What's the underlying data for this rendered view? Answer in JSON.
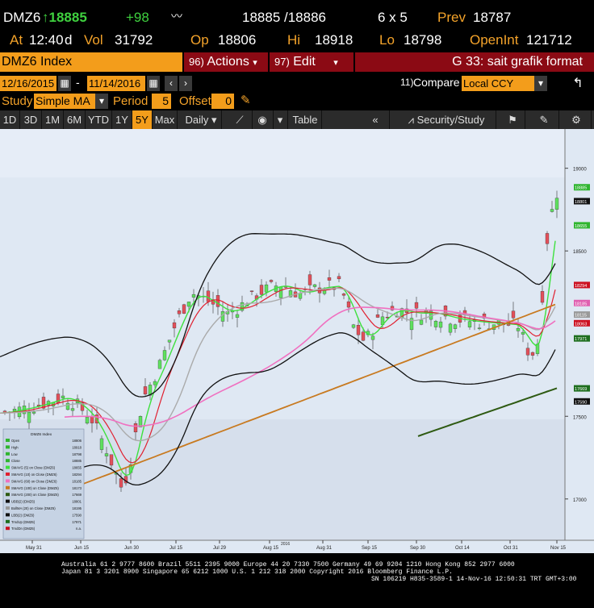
{
  "header": {
    "ticker": "DMZ6",
    "last": "↑18885",
    "change": "+98",
    "bid_ask": "18885 /18886",
    "size": "6 x 5",
    "prev_label": "Prev",
    "prev_value": "18787",
    "at_label": "At",
    "time": "12:40",
    "time_suffix": "d",
    "vol_label": "Vol",
    "vol_value": "31792",
    "op_label": "Op",
    "op_value": "18806",
    "hi_label": "Hi",
    "hi_value": "18918",
    "lo_label": "Lo",
    "lo_value": "18798",
    "oi_label": "OpenInt",
    "oi_value": "121712"
  },
  "command": {
    "security": "DMZ6 Index",
    "actions_num": "96)",
    "actions_label": "Actions",
    "edit_num": "97)",
    "edit_label": "Edit",
    "title": "G 33: sait grafik format"
  },
  "range": {
    "start": "12/16/2015",
    "end": "11/14/2016",
    "compare_num": "11)",
    "compare_label": "Compare",
    "compare_value": "Local CCY"
  },
  "study": {
    "label": "Study",
    "value": "Simple MA",
    "period_label": "Period",
    "period_value": "5",
    "offset_label": "Offset",
    "offset_value": "0"
  },
  "toolbar": {
    "periods": [
      "1D",
      "3D",
      "1M",
      "6M",
      "YTD",
      "1Y",
      "5Y",
      "Max"
    ],
    "active_period": "5Y",
    "frequency": "Daily",
    "table": "Table",
    "security_study": "Security/Study"
  },
  "chart_data": {
    "type": "line",
    "x_tick_labels": [
      "May 31",
      "Jun 15",
      "Jun 30",
      "Jul 15",
      "Jul 29",
      "Aug 15",
      "Aug 31",
      "Sep 15",
      "Sep 30",
      "Oct 14",
      "Oct 31",
      "Nov 15"
    ],
    "year_label": "2016",
    "y_tick_labels": [
      {
        "label": "19000",
        "value": 19000
      },
      {
        "label": "18500",
        "value": 18500
      },
      {
        "label": "17500",
        "value": 17500
      },
      {
        "label": "17000",
        "value": 17000
      }
    ],
    "ylim": [
      16760,
      19130
    ],
    "price_tags": [
      {
        "label": "18885",
        "value": 18885,
        "color": "#2fb52f"
      },
      {
        "label": "18801",
        "value": 18801,
        "color": "#111111"
      },
      {
        "label": "18655",
        "value": 18655,
        "color": "#2fb52f"
      },
      {
        "label": "18294",
        "value": 18294,
        "color": "#cc1020"
      },
      {
        "label": "18185",
        "value": 18185,
        "color": "#e060b0"
      },
      {
        "label": "18115",
        "value": 18115,
        "color": "#999999"
      },
      {
        "label": "18063",
        "value": 18063,
        "color": "#cc1020"
      },
      {
        "label": "17971",
        "value": 17971,
        "color": "#1d6e1d"
      },
      {
        "label": "17669",
        "value": 17669,
        "color": "#1d6e1d"
      },
      {
        "label": "17590",
        "value": 17590,
        "color": "#111111"
      }
    ],
    "legend": {
      "title": "DMZ6 Index",
      "rows": [
        {
          "name": "Open",
          "value": "18806",
          "color": "#2fb52f"
        },
        {
          "name": "High",
          "value": "18918",
          "color": "#2fb52f"
        },
        {
          "name": "Low",
          "value": "18798",
          "color": "#2fb52f"
        },
        {
          "name": "Close",
          "value": "18885",
          "color": "#2fb52f"
        },
        {
          "name": "SMAVG (5) on Close (DMZ6)",
          "value": "18655",
          "color": "#3ee03e"
        },
        {
          "name": "SMAVG (10) on Close (DMZ6)",
          "value": "18294",
          "color": "#e02030"
        },
        {
          "name": "SMAVG (60) on Close (DMZ6)",
          "value": "18185",
          "color": "#f070c0"
        },
        {
          "name": "SMAVG (100) on Close (DMZ6)",
          "value": "18173",
          "color": "#c87a20"
        },
        {
          "name": "SMAVG (200) on Close (DMZ6)",
          "value": "17669",
          "color": "#2e5a12"
        },
        {
          "name": "UBB(2) (DMZ6)",
          "value": "18801",
          "color": "#111111"
        },
        {
          "name": "BollMA (20) on Close (DMZ6)",
          "value": "18195",
          "color": "#999999"
        },
        {
          "name": "LBB(2) (DMZ6)",
          "value": "17590",
          "color": "#111111"
        },
        {
          "name": "TrndUp (DMZ6)",
          "value": "17971",
          "color": "#1d6e1d"
        },
        {
          "name": "TrndDn (DMZ6)",
          "value": "n.a.",
          "color": "#cc1020"
        }
      ]
    }
  },
  "footer": {
    "line1": "Australia 61 2 9777 8600 Brazil 5511 2395 9000 Europe 44 20 7330 7500 Germany 49 69 9204 1210 Hong Kong 852 2977 6000",
    "line2": "Japan 81 3 3201 8900        Singapore 65 6212 1000        U.S. 1 212 318 2000           Copyright 2016 Bloomberg Finance L.P.",
    "line3": "SN 106219 H835-3589-1 14-Nov-16 12:50:31 TRT  GMT+3:00"
  }
}
